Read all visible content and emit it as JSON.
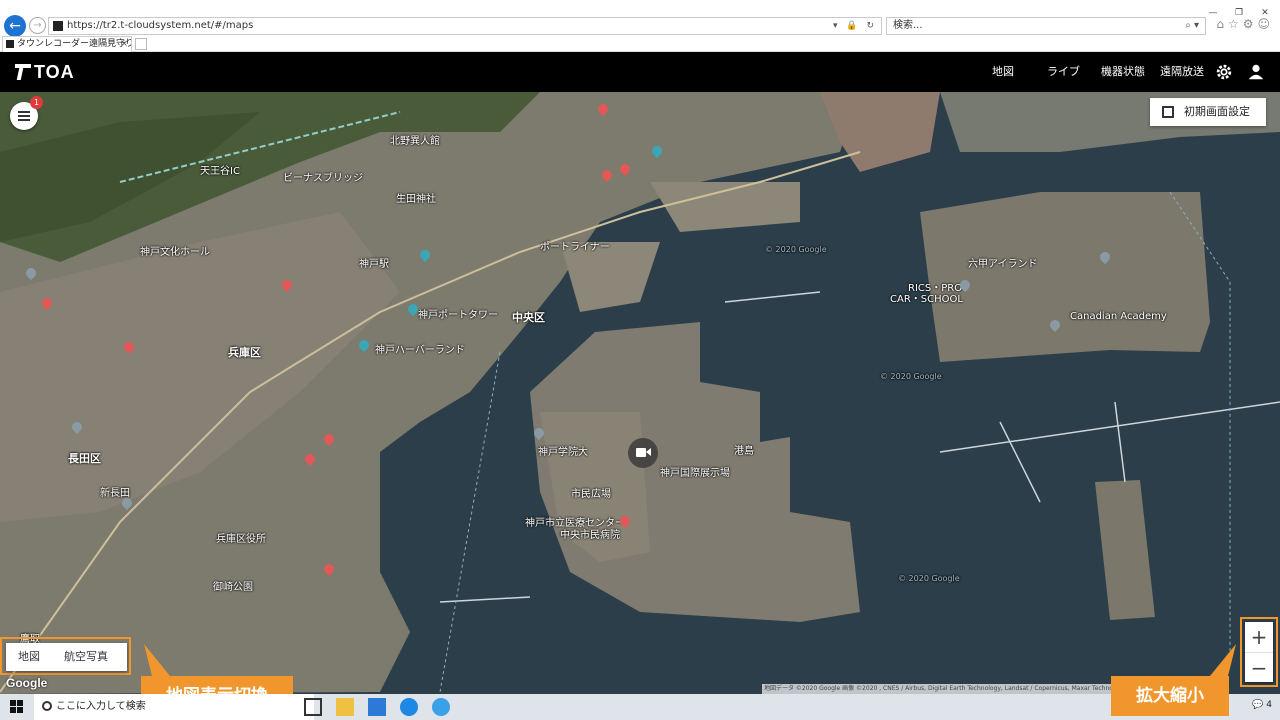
{
  "browser": {
    "url": "https://tr2.t-cloudsystem.net/#/maps",
    "search_placeholder": "検索...",
    "tab_title": "タウンレコーダー遠隔見守りサー...",
    "tab_close": "×"
  },
  "header": {
    "logo": "TOA",
    "nav": [
      "地図",
      "ライブ",
      "機器状態",
      "遠隔放送"
    ],
    "icons": [
      "gear-icon",
      "user-icon"
    ]
  },
  "map": {
    "menu_badge": "1",
    "initial_view_button": "初期画面設定",
    "map_type_options": [
      "地図",
      "航空写真"
    ],
    "zoom_in": "+",
    "zoom_out": "−",
    "google_logo": "Google",
    "attribution": "地図データ ©2020 Google 画像 ©2020 , CNES / Airbus, Digital Earth Technology, Landsat / Copernicus, Maxar Technologies",
    "labels": {
      "chuo": "中央区",
      "hyogo": "兵庫区",
      "nagata": "長田区",
      "kobe_port_tower": "神戸ポートタワー",
      "harborland": "神戸ハーバーランド",
      "rokko_island": "六甲アイランド",
      "rics": "RICS・PRO",
      "car_school": "CAR・SCHOOL",
      "canadian_academy": "Canadian Academy",
      "minatojima": "港島",
      "kobe_city_hospital": "神戸市立医療センター",
      "chuo_shimin_hospital": "中央市民病院",
      "tenjo_ic": "天王谷IC",
      "kitano": "北野異人館",
      "venus_bridge": "ビーナスブリッジ",
      "kobe_station": "神戸駅",
      "ikuta_shrine": "生田神社",
      "port_liner": "ポートライナー",
      "kobe_gakuin": "神戸学院大",
      "shimin_hiroba": "市民広場",
      "kokusai_tenjijo": "神戸国際展示場",
      "misaki_park": "御崎公園",
      "takatori": "鷹取",
      "kobe_bunka": "神戸文化ホール",
      "shin_nagata": "新長田",
      "hyogo_ward_office": "兵庫区役所",
      "copyright_1": "© 2020 Google",
      "copyright_2": "© 2020 Google",
      "copyright_3": "© 2020 Google"
    }
  },
  "callouts": {
    "map_switch": "地図表示切換",
    "zoom": "拡大縮小"
  },
  "taskbar": {
    "search": "ここに入力して検索",
    "notification_count": "4"
  },
  "colors": {
    "accent": "#f0962c",
    "header_bg": "#000000",
    "sea": "#2b3e4a",
    "badge": "#e03a3a"
  }
}
